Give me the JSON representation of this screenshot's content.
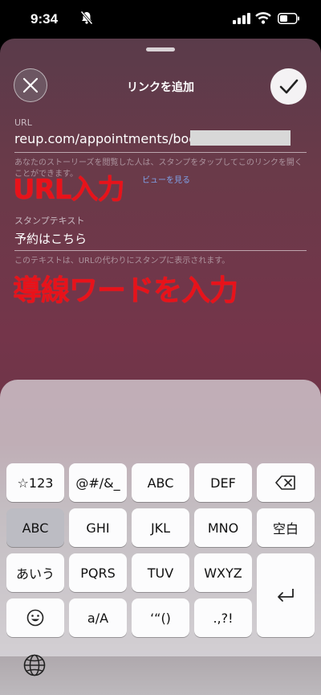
{
  "status_bar": {
    "time": "9:34"
  },
  "sheet": {
    "title": "リンクを追加",
    "url_label": "URL",
    "url_value": "reup.com/appointments/book/",
    "url_helper": "あなたのストーリーズを閲覧した人は、スタンプをタップしてこのリンクを開くことができます。",
    "preview_link": "ビューを見る",
    "sticker_label": "スタンプテキスト",
    "sticker_value": "予約はこちら",
    "sticker_helper": "このテキストは、URLの代わりにスタンプに表示されます。"
  },
  "annotations": {
    "url_note": "URL入力",
    "text_note": "導線ワードを入力"
  },
  "keyboard": {
    "rows": [
      [
        "☆123",
        "@#/&_",
        "ABC",
        "DEF"
      ],
      [
        "ABC",
        "GHI",
        "JKL",
        "MNO",
        "空白"
      ],
      [
        "あいう",
        "PQRS",
        "TUV",
        "WXYZ"
      ],
      [
        "",
        "a/A",
        "‘“()",
        ".,?!"
      ]
    ],
    "space_label": "空白"
  }
}
